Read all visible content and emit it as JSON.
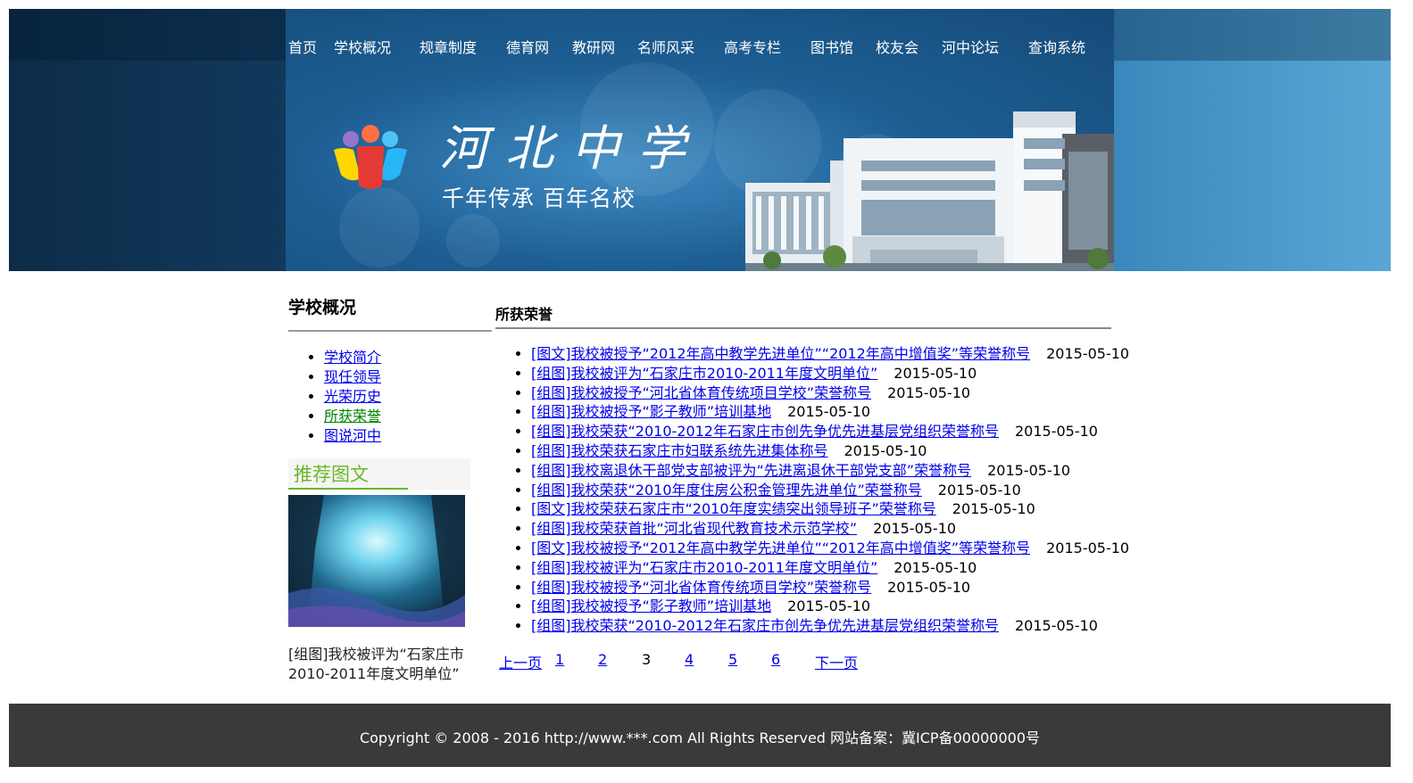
{
  "nav": {
    "items": [
      "首页",
      "学校概况",
      "规章制度",
      "德育网",
      "教研网",
      "名师风采",
      "高考专栏",
      "图书馆",
      "校友会",
      "河中论坛",
      "查询系统"
    ]
  },
  "banner": {
    "school_name": "河北中学",
    "slogan": "千年传承  百年名校"
  },
  "sidebar": {
    "title": "学校概况",
    "items": [
      "学校简介",
      "现任领导",
      "光荣历史",
      "所获荣誉",
      "图说河中"
    ],
    "active": "所获荣誉"
  },
  "recommend": {
    "title": "推荐图文",
    "caption": "[组图]我校被评为“石家庄市2010-2011年度文明单位”"
  },
  "main": {
    "title": "所获荣誉",
    "news": [
      {
        "title": "[图文]我校被授予“2012年高中教学先进单位”“2012年高中增值奖”等荣誉称号",
        "date": "2015-05-10"
      },
      {
        "title": "[组图]我校被评为“石家庄市2010-2011年度文明单位”",
        "date": "2015-05-10"
      },
      {
        "title": "[组图]我校被授予“河北省体育传统项目学校”荣誉称号",
        "date": "2015-05-10"
      },
      {
        "title": "[组图]我校被授予“影子教师”培训基地",
        "date": "2015-05-10"
      },
      {
        "title": "[组图]我校荣获“2010-2012年石家庄市创先争优先进基层党组织荣誉称号",
        "date": "2015-05-10"
      },
      {
        "title": "[组图]我校荣获石家庄市妇联系统先进集体称号",
        "date": "2015-05-10"
      },
      {
        "title": "[组图]我校离退休干部党支部被评为“先进离退休干部党支部”荣誉称号",
        "date": "2015-05-10"
      },
      {
        "title": "[组图]我校荣获“2010年度住房公积金管理先进单位”荣誉称号",
        "date": "2015-05-10"
      },
      {
        "title": "[图文]我校荣获石家庄市“2010年度实绩突出领导班子”荣誉称号",
        "date": "2015-05-10"
      },
      {
        "title": "[组图]我校荣获首批“河北省现代教育技术示范学校”",
        "date": "2015-05-10"
      },
      {
        "title": "[图文]我校被授予“2012年高中教学先进单位”“2012年高中增值奖”等荣誉称号",
        "date": "2015-05-10"
      },
      {
        "title": "[组图]我校被评为“石家庄市2010-2011年度文明单位”",
        "date": "2015-05-10"
      },
      {
        "title": "[组图]我校被授予“河北省体育传统项目学校”荣誉称号",
        "date": "2015-05-10"
      },
      {
        "title": "[组图]我校被授予“影子教师”培训基地",
        "date": "2015-05-10"
      },
      {
        "title": "[组图]我校荣获“2010-2012年石家庄市创先争优先进基层党组织荣誉称号",
        "date": "2015-05-10"
      }
    ]
  },
  "pager": {
    "prev": "上一页",
    "pages": [
      "1",
      "2",
      "3",
      "4",
      "5",
      "6"
    ],
    "current": "3",
    "next": "下一页"
  },
  "footer": {
    "copyright": "Copyright © 2008 - 2016 http://www.***.com All Rights Reserved 网站备案：冀ICP备00000000号"
  },
  "colors": {
    "link": "#0000ee",
    "active_link": "#008000",
    "accent_green": "#6ab82a",
    "footer_bg": "#3a3a3a"
  }
}
